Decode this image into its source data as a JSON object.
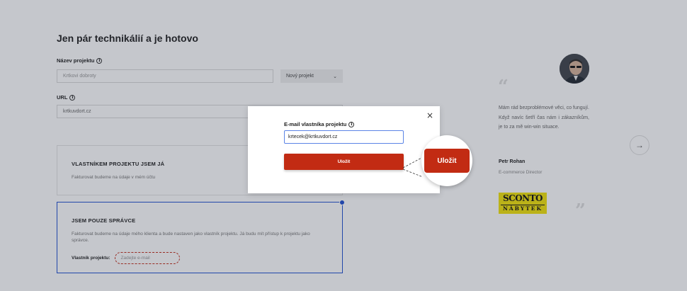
{
  "page": {
    "title": "Jen pár technikálií a je hotovo",
    "project_name_label": "Název projektu",
    "project_name_placeholder": "Krtkovi dobroty",
    "project_select_value": "Nový projekt",
    "url_label": "URL",
    "url_value": "krtkuvdort.cz"
  },
  "options": [
    {
      "title": "VLASTNÍKEM PROJEKTU JSEM JÁ",
      "subtitle": "Fakturovat budeme na údaje v mém účtu",
      "selected": false
    },
    {
      "title": "JSEM POUZE SPRÁVCE",
      "subtitle": "Fakturovat budeme na údaje mého klienta a bude nastaven jako vlastník projektu. Já budu mít přístup k projektu jako správce.",
      "owner_label": "Vlastník projektu:",
      "owner_placeholder": "Zadejte e-mail",
      "selected": true
    }
  ],
  "testimonial": {
    "quote_open": "“",
    "quote_close": "”",
    "text": "Mám rád bezproblémové věci, co fungují. Když navíc šetří čas nám i zákazníkům, je to za mě win-win situace.",
    "name": "Petr Rohan",
    "role": "E-commerce Director",
    "logo_line1": "SCONTO",
    "logo_line2": "NÁBYTEK",
    "next_arrow": "→"
  },
  "modal": {
    "label": "E-mail vlastníka projektu",
    "email_value": "krtecek@krtkuvdort.cz",
    "save_label": "Uložit",
    "close_glyph": "×",
    "zoom_label": "Uložit"
  },
  "icons": {
    "info": "i"
  },
  "colors": {
    "accent_red": "#c22b13",
    "active_blue": "#1f4fd1",
    "logo_yellow": "#f1e20a"
  }
}
